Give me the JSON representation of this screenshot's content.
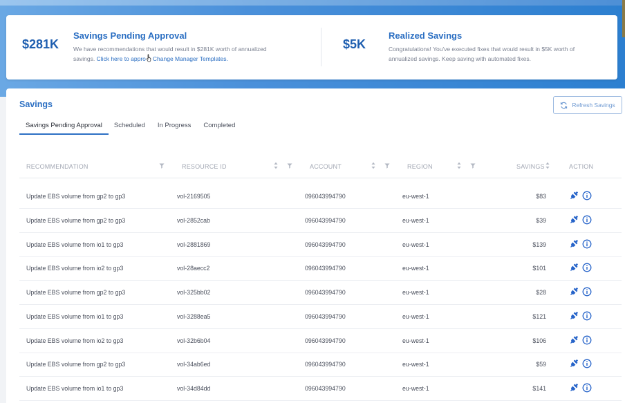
{
  "summary": {
    "pending": {
      "amount": "$281K",
      "title": "Savings Pending Approval",
      "desc_line1": "We have recommendations that would result in $281K worth of annualized",
      "desc_prefix": "savings. ",
      "desc_link": "Click here to appro",
      "desc_link2": "Change Manager Templates."
    },
    "realized": {
      "amount": "$5K",
      "title": "Realized Savings",
      "desc_line1": "Congratulations! You've executed fixes that would result in $5K worth of",
      "desc_line2": "annualized savings. Keep saving with automated fixes."
    }
  },
  "panel": {
    "title": "Savings",
    "refresh_label": "Refresh Savings",
    "tabs": [
      {
        "label": "Savings Pending Approval",
        "active": true
      },
      {
        "label": "Scheduled"
      },
      {
        "label": "In Progress"
      },
      {
        "label": "Completed"
      }
    ]
  },
  "table": {
    "headers": {
      "recommendation": "RECOMMENDATION",
      "resource_id": "RESOURCE ID",
      "account": "ACCOUNT",
      "region": "REGION",
      "savings": "SAVINGS",
      "action": "ACTION"
    },
    "rows": [
      {
        "recommendation": "Update EBS volume from gp2 to gp3",
        "resource_id": "vol-2169505",
        "account": "096043994790",
        "region": "eu-west-1",
        "savings": "$83"
      },
      {
        "recommendation": "Update EBS volume from gp2 to gp3",
        "resource_id": "vol-2852cab",
        "account": "096043994790",
        "region": "eu-west-1",
        "savings": "$39"
      },
      {
        "recommendation": "Update EBS volume from io1 to gp3",
        "resource_id": "vol-2881869",
        "account": "096043994790",
        "region": "eu-west-1",
        "savings": "$139"
      },
      {
        "recommendation": "Update EBS volume from io2 to gp3",
        "resource_id": "vol-28aecc2",
        "account": "096043994790",
        "region": "eu-west-1",
        "savings": "$101"
      },
      {
        "recommendation": "Update EBS volume from gp2 to gp3",
        "resource_id": "vol-325bb02",
        "account": "096043994790",
        "region": "eu-west-1",
        "savings": "$28"
      },
      {
        "recommendation": "Update EBS volume from io1 to gp3",
        "resource_id": "vol-3288ea5",
        "account": "096043994790",
        "region": "eu-west-1",
        "savings": "$121"
      },
      {
        "recommendation": "Update EBS volume from io2 to gp3",
        "resource_id": "vol-32b6b04",
        "account": "096043994790",
        "region": "eu-west-1",
        "savings": "$106"
      },
      {
        "recommendation": "Update EBS volume from gp2 to gp3",
        "resource_id": "vol-34ab6ed",
        "account": "096043994790",
        "region": "eu-west-1",
        "savings": "$59"
      },
      {
        "recommendation": "Update EBS volume from io1 to gp3",
        "resource_id": "vol-34d84dd",
        "account": "096043994790",
        "region": "eu-west-1",
        "savings": "$141"
      }
    ]
  },
  "colors": {
    "brand": "#2a6ec2",
    "banner": "#4a90da",
    "action_icon": "#2563c9"
  },
  "icons": {
    "refresh": "refresh-icon",
    "sort": "sort-icon",
    "filter": "filter-icon",
    "execute": "execute-plug-icon",
    "info": "info-icon",
    "cursor": "hand-cursor-icon"
  }
}
